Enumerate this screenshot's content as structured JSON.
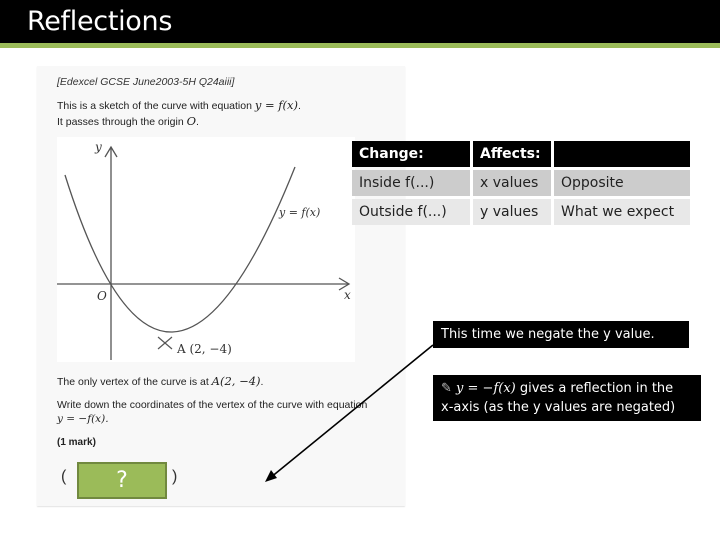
{
  "slide": {
    "title": "Reflections",
    "accent_color": "#9bbb59"
  },
  "question": {
    "source": "[Edexcel GCSE June2003-5H Q24aiii]",
    "intro_prefix": "This is a sketch of the curve with equation ",
    "intro_equation": "y = f(x)",
    "intro_line2_prefix": "It passes through the origin ",
    "intro_line2_var": "O",
    "vertex_prefix": "The only vertex of the curve is at ",
    "vertex_point": "A(2, −4)",
    "task_line1": "Write down the coordinates of the vertex of the curve with equation",
    "task_line2": "y = −f(x).",
    "marks": "(1 mark)",
    "answer_open": "(",
    "answer_placeholder": "?",
    "answer_close": ")"
  },
  "graph": {
    "y_axis_label": "y",
    "x_axis_label": "x",
    "origin_label": "O",
    "curve_label": "y = f(x)",
    "vertex_label": "A (2, −4)"
  },
  "rules_table": {
    "headers": [
      "Change:",
      "Affects:",
      ""
    ],
    "rows": [
      [
        "Inside f(...)",
        "x values",
        "Opposite"
      ],
      [
        "Outside f(...)",
        "y values",
        "What we expect"
      ]
    ]
  },
  "notes": {
    "hint": "This time we negate the y value.",
    "rule_icon": "pencil-icon",
    "rule_equation": "y = −f(x)",
    "rule_text_1": " gives a reflection in the",
    "rule_text_2": "x-axis (as the y values are negated)"
  }
}
